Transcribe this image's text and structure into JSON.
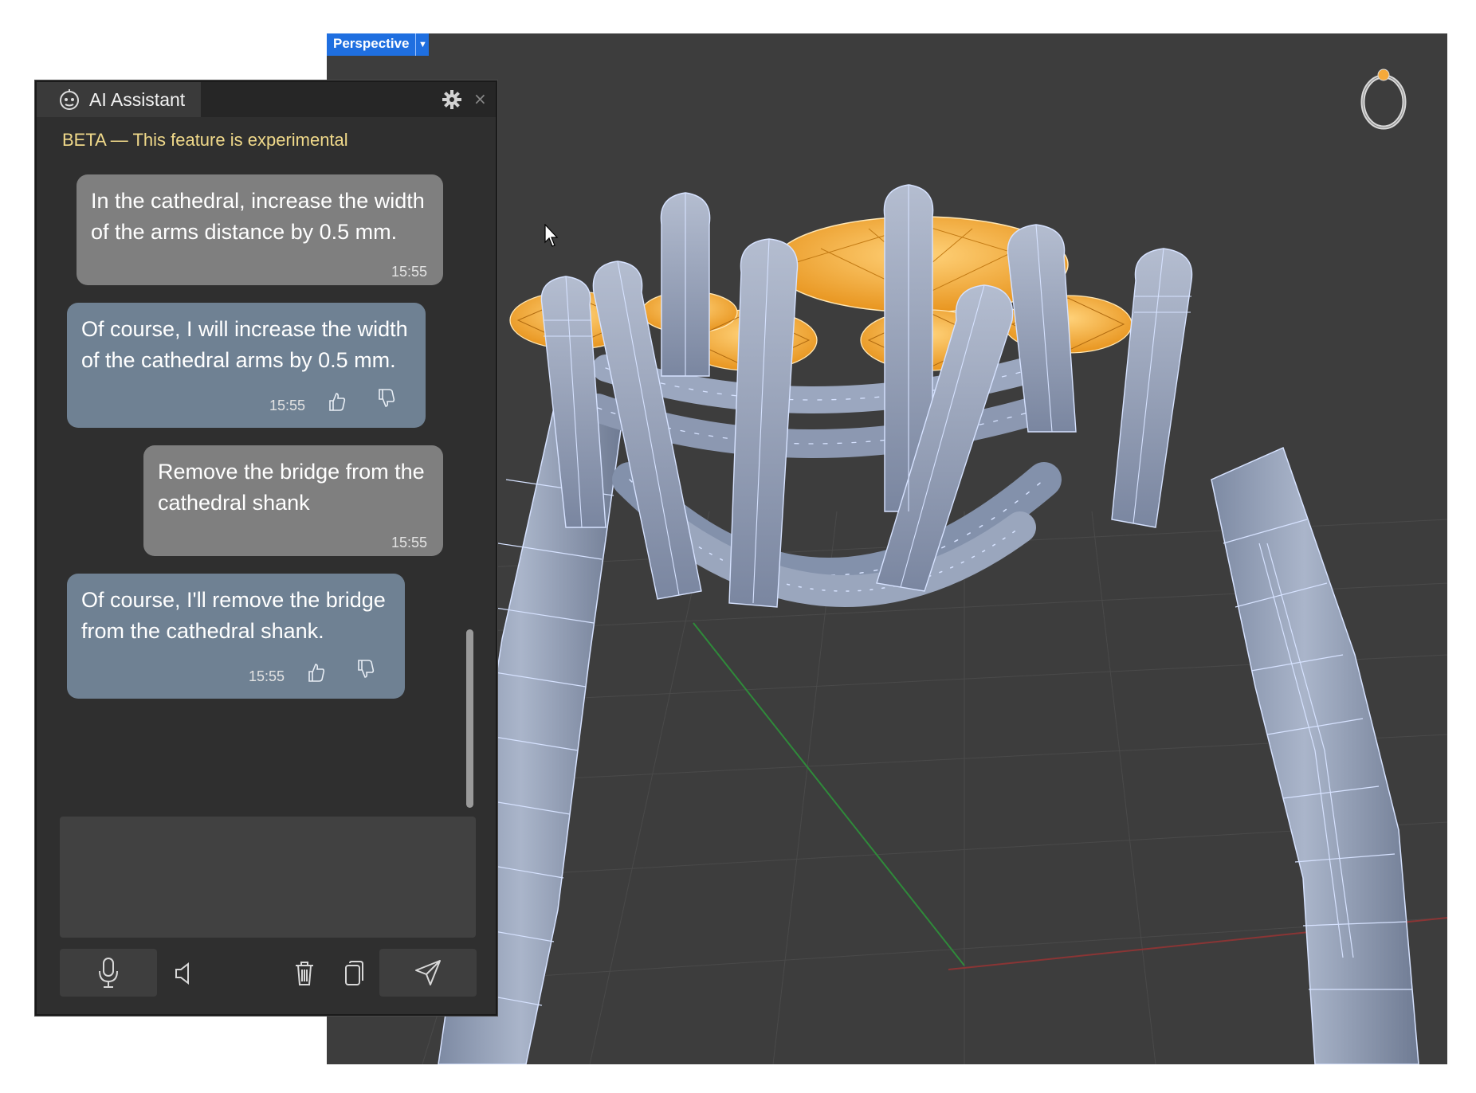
{
  "viewport": {
    "view_label": "Perspective",
    "view_dropdown_icon": "triangle-down-icon",
    "gizmo_icon": "ring-thumbnail-icon",
    "gem_color": "#f5a93a",
    "metal_color": "#9aa6bd",
    "wire_color": "#d6e2ff",
    "background_color": "#3d3d3d"
  },
  "panel": {
    "title": "AI Assistant",
    "title_icon": "robot-icon",
    "settings_icon": "gear-icon",
    "close_label": "×",
    "beta_notice": "BETA — This feature is experimental",
    "messages": [
      {
        "role": "user",
        "text": "In the cathedral, increase the width\nof the arms distance by 0.5 mm.",
        "time": "15:55"
      },
      {
        "role": "assistant",
        "text": "Of course, I will increase the width\nof the cathedral arms by 0.5 mm.",
        "time": "15:55"
      },
      {
        "role": "user",
        "text": "Remove the bridge from the\ncathedral shank",
        "time": "15:55"
      },
      {
        "role": "assistant",
        "text": "Of course, I'll remove the bridge\nfrom the cathedral shank.",
        "time": "15:55"
      }
    ],
    "input": {
      "value": "",
      "placeholder": ""
    },
    "toolbar": {
      "mic_icon": "microphone-icon",
      "speaker_icon": "speaker-icon",
      "trash_icon": "trash-icon",
      "copy_icon": "copy-icon",
      "send_icon": "send-icon"
    }
  },
  "colors": {
    "user_bubble": "#7f7f7f",
    "assistant_bubble": "#6f8193",
    "beta_text": "#f0d98a",
    "view_label_bg": "#1f6fe0"
  }
}
